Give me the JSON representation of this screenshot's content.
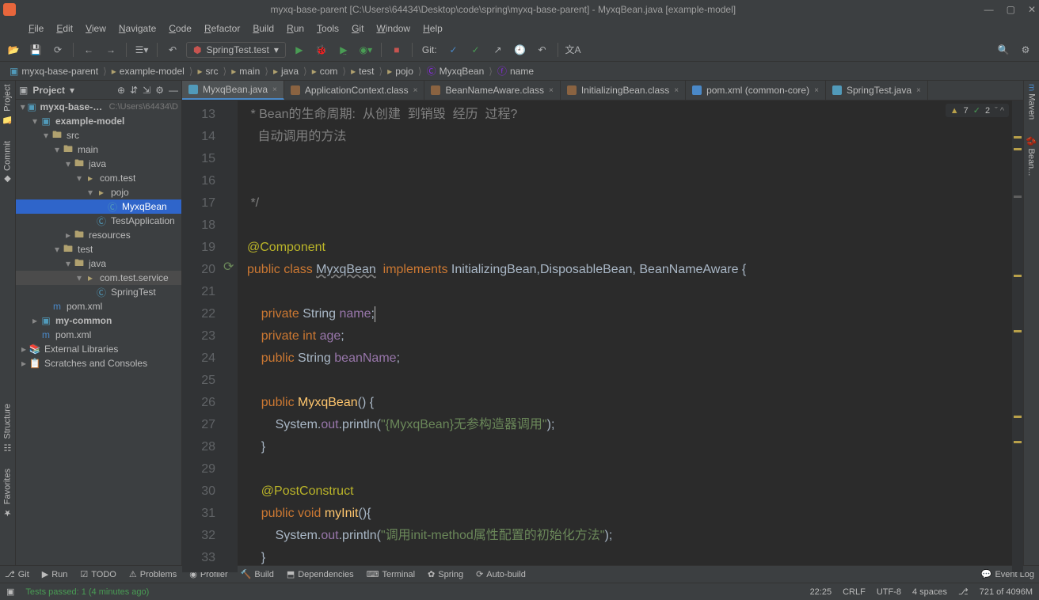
{
  "window": {
    "title": "myxq-base-parent [C:\\Users\\64434\\Desktop\\code\\spring\\myxq-base-parent] - MyxqBean.java [example-model]"
  },
  "menu": [
    "File",
    "Edit",
    "View",
    "Navigate",
    "Code",
    "Refactor",
    "Build",
    "Run",
    "Tools",
    "Git",
    "Window",
    "Help"
  ],
  "toolbar": {
    "runconfig": "SpringTest.test",
    "vcs_label": "Git:"
  },
  "breadcrumbs": [
    "myxq-base-parent",
    "example-model",
    "src",
    "main",
    "java",
    "com",
    "test",
    "pojo",
    "MyxqBean",
    "name"
  ],
  "project": {
    "title": "Project",
    "root_name": "myxq-base-parent",
    "root_path": "C:\\Users\\64434\\D",
    "tree": [
      {
        "indent": 1,
        "arrow": "▾",
        "icon": "module",
        "label": "example-model",
        "bold": true
      },
      {
        "indent": 2,
        "arrow": "▾",
        "icon": "folder",
        "label": "src"
      },
      {
        "indent": 3,
        "arrow": "▾",
        "icon": "folder",
        "label": "main"
      },
      {
        "indent": 4,
        "arrow": "▾",
        "icon": "folder",
        "label": "java"
      },
      {
        "indent": 5,
        "arrow": "▾",
        "icon": "pkg",
        "label": "com.test"
      },
      {
        "indent": 6,
        "arrow": "▾",
        "icon": "pkg",
        "label": "pojo"
      },
      {
        "indent": 7,
        "arrow": "",
        "icon": "class",
        "label": "MyxqBean",
        "selected": true
      },
      {
        "indent": 6,
        "arrow": "",
        "icon": "class",
        "label": "TestApplication"
      },
      {
        "indent": 4,
        "arrow": "▸",
        "icon": "folder",
        "label": "resources"
      },
      {
        "indent": 3,
        "arrow": "▾",
        "icon": "folder",
        "label": "test"
      },
      {
        "indent": 4,
        "arrow": "▾",
        "icon": "folder",
        "label": "java"
      },
      {
        "indent": 5,
        "arrow": "▾",
        "icon": "pkg",
        "label": "com.test.service",
        "highlight": true
      },
      {
        "indent": 6,
        "arrow": "",
        "icon": "class",
        "label": "SpringTest"
      },
      {
        "indent": 2,
        "arrow": "",
        "icon": "maven",
        "label": "pom.xml"
      },
      {
        "indent": 1,
        "arrow": "▸",
        "icon": "module",
        "label": "my-common",
        "bold": true
      },
      {
        "indent": 1,
        "arrow": "",
        "icon": "maven",
        "label": "pom.xml"
      },
      {
        "indent": 0,
        "arrow": "▸",
        "icon": "lib",
        "label": "External Libraries"
      },
      {
        "indent": 0,
        "arrow": "▸",
        "icon": "scratch",
        "label": "Scratches and Consoles"
      }
    ]
  },
  "editor_tabs": [
    {
      "label": "MyxqBean.java",
      "icon": "#519aba",
      "active": true
    },
    {
      "label": "ApplicationContext.class",
      "icon": "#8a6341"
    },
    {
      "label": "BeanNameAware.class",
      "icon": "#8a6341"
    },
    {
      "label": "InitializingBean.class",
      "icon": "#8a6341"
    },
    {
      "label": "pom.xml (common-core)",
      "icon": "#4a88c7"
    },
    {
      "label": "SpringTest.java",
      "icon": "#519aba"
    }
  ],
  "editor": {
    "first_line": 13,
    "inspection": {
      "warnings": "7",
      "weak": "2"
    },
    "code_lines": [
      {
        "t": "comment",
        "text": " * Bean的生命周期:  从创建  到销毁  经历  过程?"
      },
      {
        "t": "comment",
        "text": "   自动调用的方法"
      },
      {
        "t": "blank",
        "text": ""
      },
      {
        "t": "blank",
        "text": ""
      },
      {
        "t": "comment",
        "text": " */"
      },
      {
        "t": "blank",
        "text": ""
      },
      {
        "t": "annot",
        "text": "@Component"
      },
      {
        "t": "classdecl"
      },
      {
        "t": "blank",
        "text": ""
      },
      {
        "t": "field1"
      },
      {
        "t": "field2"
      },
      {
        "t": "field3"
      },
      {
        "t": "blank",
        "text": ""
      },
      {
        "t": "ctor_open"
      },
      {
        "t": "ctor_body"
      },
      {
        "t": "brace",
        "text": "    }"
      },
      {
        "t": "blank",
        "text": ""
      },
      {
        "t": "annot",
        "text": "    @PostConstruct"
      },
      {
        "t": "method_open"
      },
      {
        "t": "method_body"
      },
      {
        "t": "brace",
        "text": "    }"
      }
    ],
    "strings": {
      "ctor": "\"{MyxqBean}无参构造器调用\"",
      "init": "\"调用init-method属性配置的初始化方法\""
    },
    "identifiers": {
      "class_name": "MyxqBean",
      "impl": "InitializingBean,DisposableBean, BeanNameAware",
      "name_field": "name",
      "age_field": "age",
      "bean_name_field": "beanName",
      "myinit": "myInit"
    }
  },
  "left_tools": [
    "Commit",
    "Project"
  ],
  "left_tools_bottom": [
    "Structure",
    "Favorites"
  ],
  "right_tools": [
    "Maven",
    "Bean..."
  ],
  "bottom_tools": [
    "Git",
    "Run",
    "TODO",
    "Problems",
    "Profiler",
    "Build",
    "Dependencies",
    "Terminal",
    "Spring",
    "Auto-build"
  ],
  "bottom_right": "Event Log",
  "status": {
    "msg": "Tests passed: 1 (4 minutes ago)",
    "pos": "22:25",
    "eol": "CRLF",
    "enc": "UTF-8",
    "indent": "4 spaces",
    "branch_icon": "⎇",
    "mem": "721 of 4096M"
  }
}
